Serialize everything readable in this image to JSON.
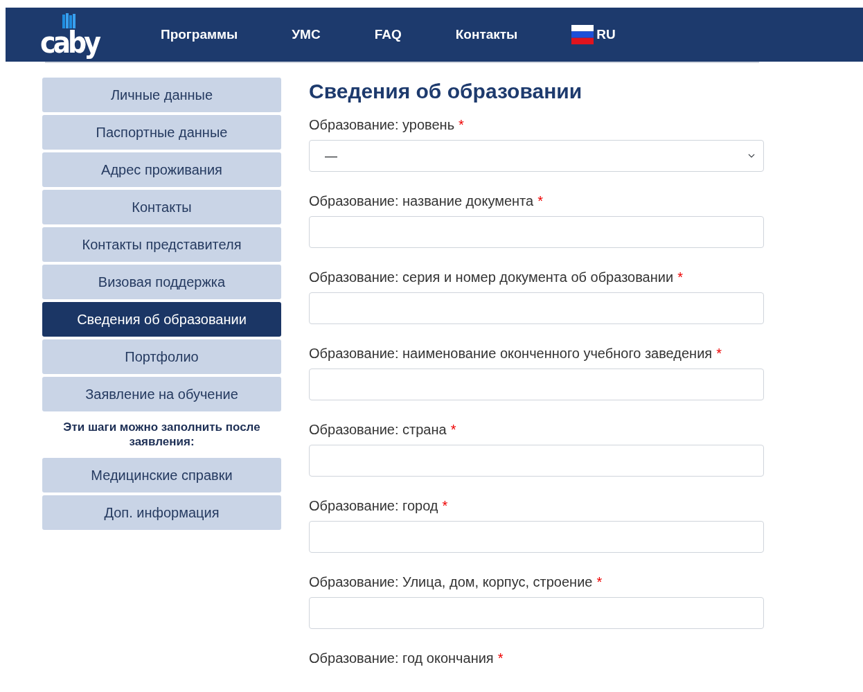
{
  "logo": {
    "text": "caby"
  },
  "nav": [
    {
      "label": "Программы",
      "kind": "link"
    },
    {
      "label": "УМС",
      "kind": "link"
    },
    {
      "label": "FAQ",
      "kind": "link"
    },
    {
      "label": "Контакты",
      "kind": "link"
    },
    {
      "label": "RU",
      "kind": "language"
    }
  ],
  "sidebar": {
    "items": [
      {
        "label": "Личные данные",
        "selected": false
      },
      {
        "label": "Паспортные данные",
        "selected": false
      },
      {
        "label": "Адрес проживания",
        "selected": false
      },
      {
        "label": "Контакты",
        "selected": false
      },
      {
        "label": "Контакты представителя",
        "selected": false
      },
      {
        "label": "Визовая поддержка",
        "selected": false
      },
      {
        "label": "Сведения об образовании",
        "selected": true
      },
      {
        "label": "Портфолио",
        "selected": false
      },
      {
        "label": "Заявление на обучение",
        "selected": false
      }
    ],
    "note": "Эти шаги можно заполнить после заявления:",
    "later_items": [
      {
        "label": "Медицинские справки",
        "selected": false
      },
      {
        "label": "Доп. информация",
        "selected": false
      }
    ]
  },
  "form": {
    "title": "Сведения об образовании",
    "fields": [
      {
        "label": "Образование: уровень",
        "required_mark": "*",
        "kind": "select",
        "value": "—"
      },
      {
        "label": "Образование: название документа",
        "required_mark": "*",
        "kind": "text"
      },
      {
        "label": "Образование: серия и номер документа об образовании",
        "required_mark": "*",
        "kind": "text"
      },
      {
        "label": "Образование: наименование оконченного учебного заведения",
        "required_mark": "*",
        "kind": "text"
      },
      {
        "label": "Образование: страна",
        "required_mark": "*",
        "kind": "text"
      },
      {
        "label": "Образование: город",
        "required_mark": "*",
        "kind": "text"
      },
      {
        "label": "Образование: Улица, дом, корпус, строение",
        "required_mark": "*",
        "kind": "text"
      },
      {
        "label": "Образование: год окончания",
        "required_mark": "*"
      }
    ]
  }
}
